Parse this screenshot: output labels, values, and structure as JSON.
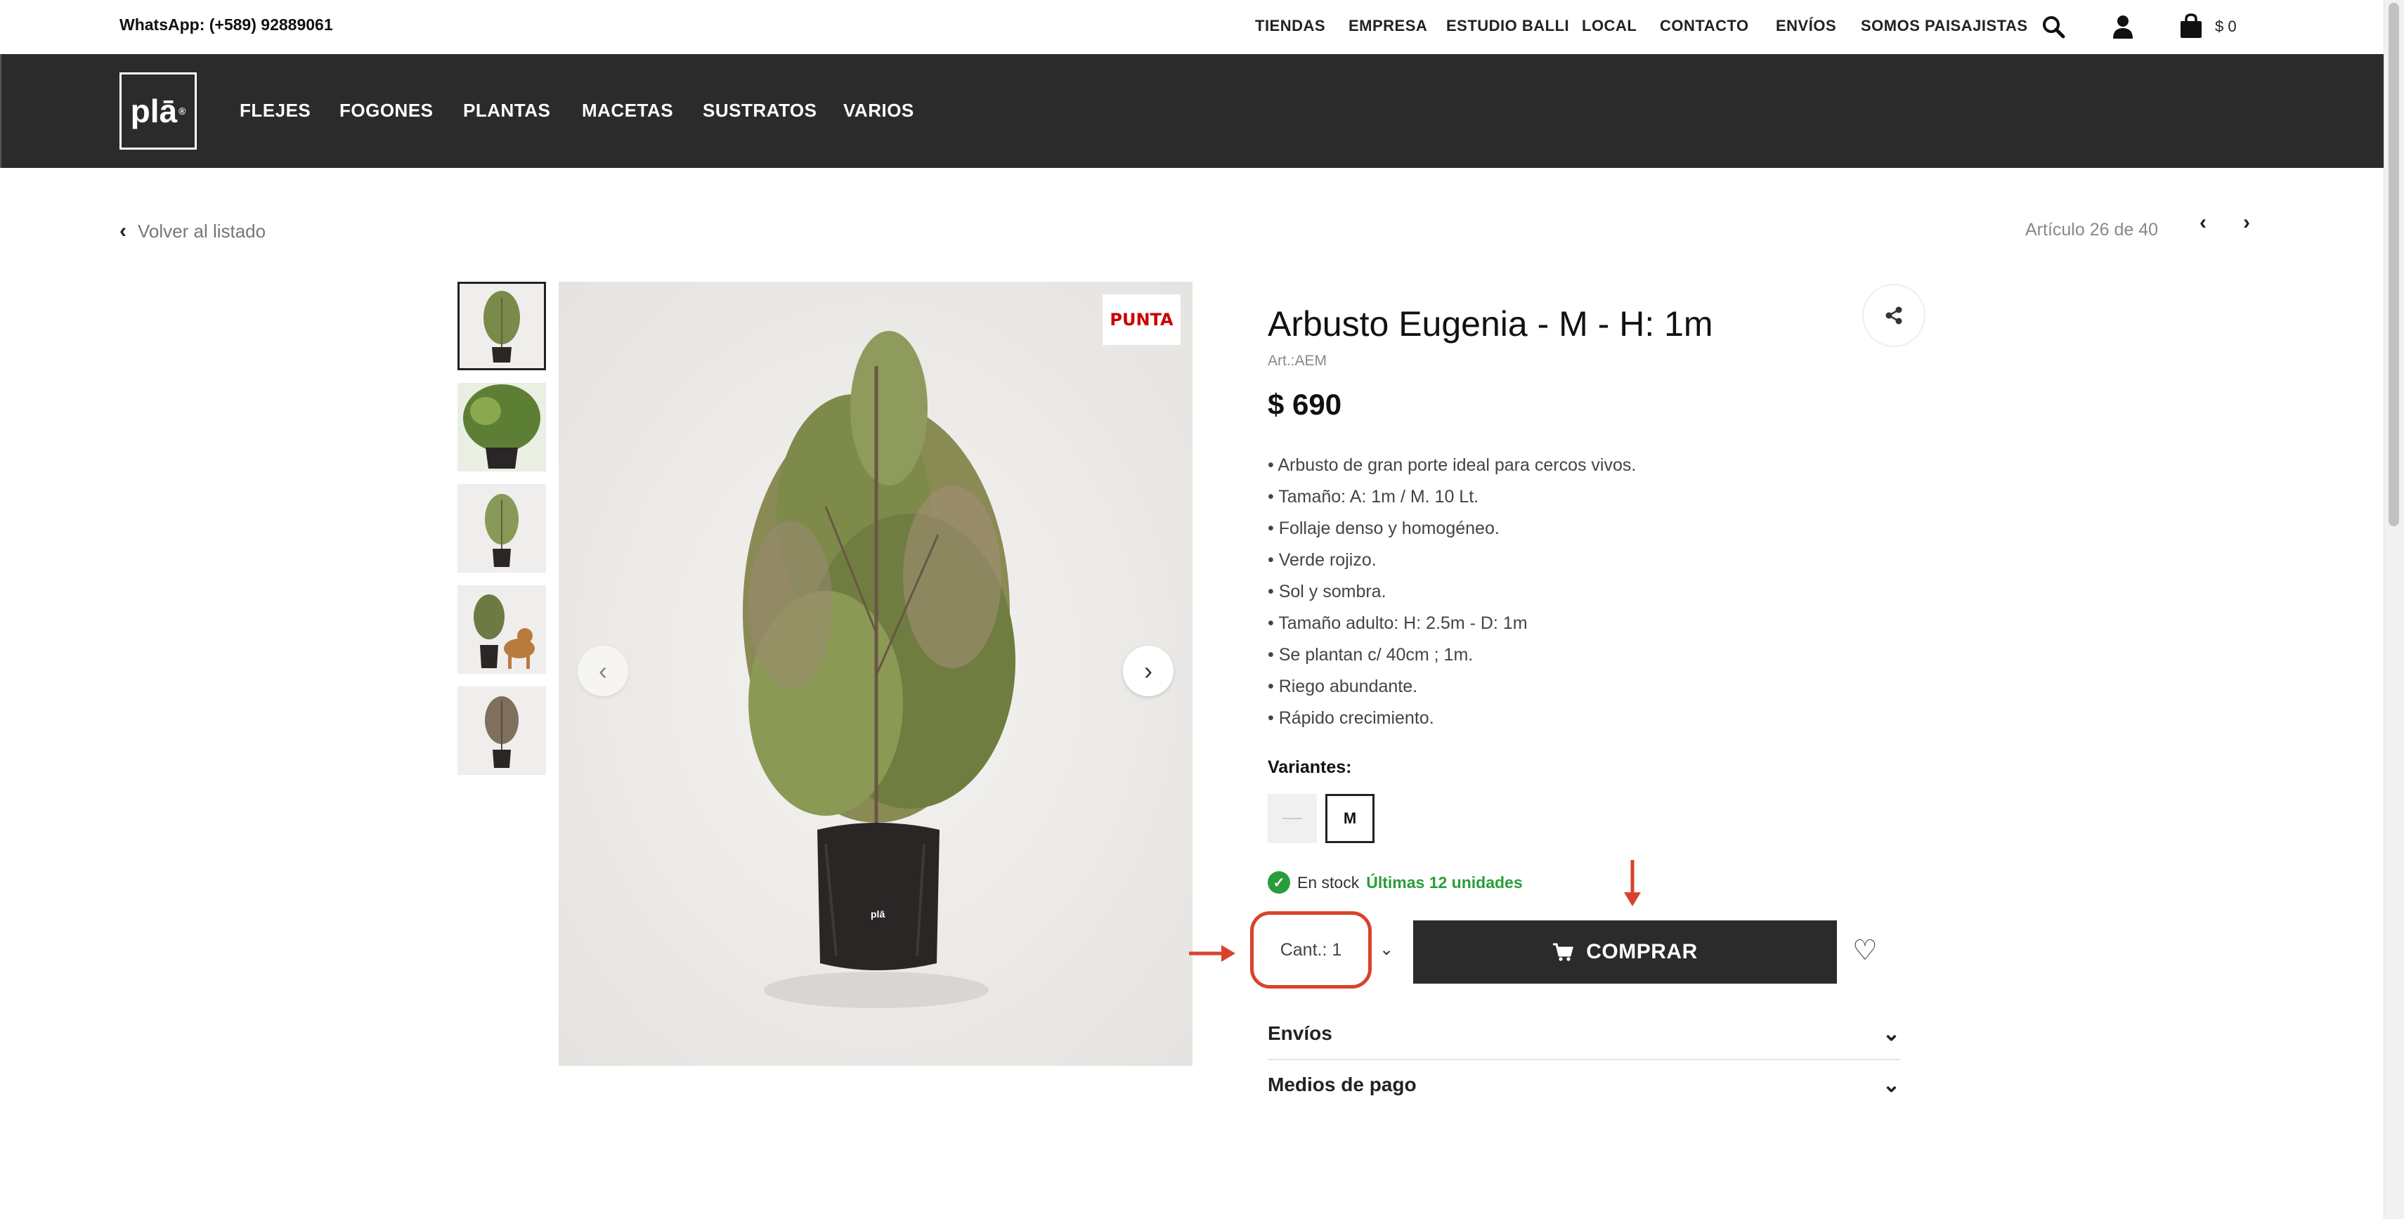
{
  "topbar": {
    "whatsapp": "WhatsApp: (+589) 92889061",
    "links": [
      "TIENDAS",
      "EMPRESA",
      "ESTUDIO BALLI",
      "LOCAL",
      "CONTACTO",
      "ENVÍOS",
      "SOMOS PAISAJISTAS"
    ],
    "cart_total": "$ 0",
    "icons": [
      "search-icon",
      "user-icon",
      "cart-icon"
    ]
  },
  "nav": {
    "logo_text": "plā",
    "logo_mark": "®",
    "items": [
      "FLEJES",
      "FOGONES",
      "PLANTAS",
      "MACETAS",
      "SUSTRATOS",
      "VARIOS"
    ]
  },
  "breadcrumb": {
    "back_label": "Volver al listado",
    "article_position": "Artículo 26 de 40"
  },
  "gallery": {
    "thumbnail_count": 5,
    "active_index": 0,
    "badge_text": "PUNTA",
    "pot_label": "plā"
  },
  "product": {
    "title": "Arbusto Eugenia - M - H: 1m",
    "sku": "Art.:AEM",
    "price": "$ 690",
    "features": [
      "• Arbusto de gran porte ideal para cercos vivos.",
      "• Tamaño: A: 1m / M. 10 Lt.",
      "• Follaje denso y homogéneo.",
      "• Verde rojizo.",
      "• Sol y sombra.",
      "• Tamaño adulto: H: 2.5m - D: 1m",
      "• Se plantan c/ 40cm ; 1m.",
      "• Riego abundante.",
      "• Rápido crecimiento."
    ],
    "variants_label": "Variantes:",
    "variants": [
      "",
      "M"
    ],
    "selected_variant": "M",
    "stock_label": "En stock",
    "stock_units": "Últimas 12 unidades",
    "quantity_label": "Cant.: 1",
    "buy_label": "COMPRAR"
  },
  "accordions": [
    "Envíos",
    "Medios de pago"
  ],
  "colors": {
    "dark": "#2b2b2b",
    "annotation": "#d9432b",
    "stock_green": "#2a9d3a"
  }
}
